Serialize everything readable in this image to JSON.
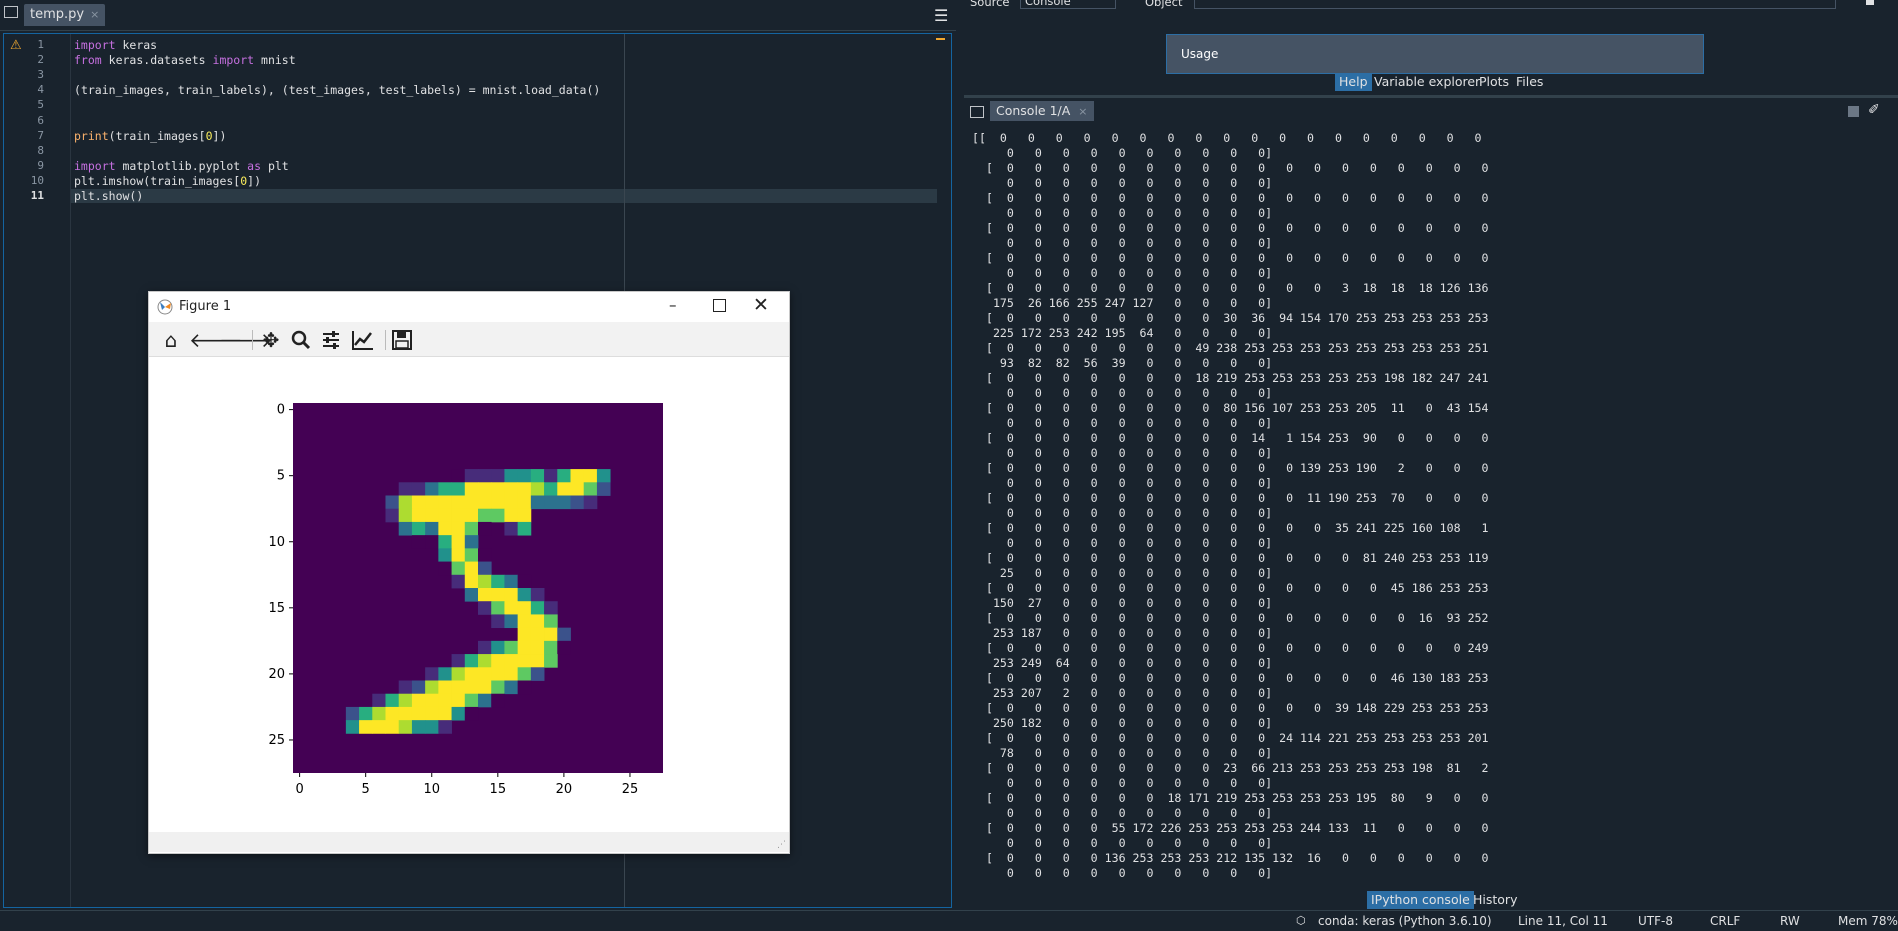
{
  "editor": {
    "tab_label": "temp.py",
    "tab_close": "×",
    "lines": [
      {
        "n": "1",
        "code": "import keras"
      },
      {
        "n": "2",
        "code": "from keras.datasets import mnist"
      },
      {
        "n": "3",
        "code": ""
      },
      {
        "n": "4",
        "code": "(train_images, train_labels), (test_images, test_labels) = mnist.load_data()"
      },
      {
        "n": "5",
        "code": ""
      },
      {
        "n": "6",
        "code": ""
      },
      {
        "n": "7",
        "code": "print(train_images[0])"
      },
      {
        "n": "8",
        "code": ""
      },
      {
        "n": "9",
        "code": "import matplotlib.pyplot as plt"
      },
      {
        "n": "10",
        "code": "plt.imshow(train_images[0])"
      },
      {
        "n": "11",
        "code": "plt.show()"
      }
    ]
  },
  "figure": {
    "title": "Figure 1",
    "y_ticks": [
      "0",
      "5",
      "10",
      "15",
      "20",
      "25"
    ],
    "x_ticks": [
      "0",
      "5",
      "10",
      "15",
      "20",
      "25"
    ],
    "colors": {
      "background": "#440154",
      "foreground": "#fde725"
    }
  },
  "right_pane": {
    "top_labels": {
      "source": "Source",
      "source_value": "Console",
      "object": "Object"
    },
    "usage_label": "Usage",
    "tabs": [
      "Help",
      "Variable explorer",
      "Plots",
      "Files"
    ],
    "console_tab": "Console 1/A",
    "console_tab_close": "×",
    "bottom_tabs": [
      "IPython console",
      "History"
    ],
    "console_lines": [
      "[[  0   0   0   0   0   0   0   0   0   0   0   0   0   0   0   0   0   0",
      "     0   0   0   0   0   0   0   0   0   0]",
      "  [  0   0   0   0   0   0   0   0   0   0   0   0   0   0   0   0   0   0",
      "     0   0   0   0   0   0   0   0   0   0]",
      "  [  0   0   0   0   0   0   0   0   0   0   0   0   0   0   0   0   0   0",
      "     0   0   0   0   0   0   0   0   0   0]",
      "  [  0   0   0   0   0   0   0   0   0   0   0   0   0   0   0   0   0   0",
      "     0   0   0   0   0   0   0   0   0   0]",
      "  [  0   0   0   0   0   0   0   0   0   0   0   0   0   0   0   0   0   0",
      "     0   0   0   0   0   0   0   0   0   0]",
      "  [  0   0   0   0   0   0   0   0   0   0   0   0   3  18  18  18 126 136",
      "   175  26 166 255 247 127   0   0   0   0]",
      "  [  0   0   0   0   0   0   0   0  30  36  94 154 170 253 253 253 253 253",
      "   225 172 253 242 195  64   0   0   0   0]",
      "  [  0   0   0   0   0   0   0  49 238 253 253 253 253 253 253 253 253 251",
      "    93  82  82  56  39   0   0   0   0   0]",
      "  [  0   0   0   0   0   0   0  18 219 253 253 253 253 253 198 182 247 241",
      "     0   0   0   0   0   0   0   0   0   0]",
      "  [  0   0   0   0   0   0   0   0  80 156 107 253 253 205  11   0  43 154",
      "     0   0   0   0   0   0   0   0   0   0]",
      "  [  0   0   0   0   0   0   0   0   0  14   1 154 253  90   0   0   0   0",
      "     0   0   0   0   0   0   0   0   0   0]",
      "  [  0   0   0   0   0   0   0   0   0   0   0 139 253 190   2   0   0   0",
      "     0   0   0   0   0   0   0   0   0   0]",
      "  [  0   0   0   0   0   0   0   0   0   0   0  11 190 253  70   0   0   0",
      "     0   0   0   0   0   0   0   0   0   0]",
      "  [  0   0   0   0   0   0   0   0   0   0   0   0  35 241 225 160 108   1",
      "     0   0   0   0   0   0   0   0   0   0]",
      "  [  0   0   0   0   0   0   0   0   0   0   0   0   0  81 240 253 253 119",
      "    25   0   0   0   0   0   0   0   0   0]",
      "  [  0   0   0   0   0   0   0   0   0   0   0   0   0   0  45 186 253 253",
      "   150  27   0   0   0   0   0   0   0   0]",
      "  [  0   0   0   0   0   0   0   0   0   0   0   0   0   0   0  16  93 252",
      "   253 187   0   0   0   0   0   0   0   0]",
      "  [  0   0   0   0   0   0   0   0   0   0   0   0   0   0   0   0   0 249",
      "   253 249  64   0   0   0   0   0   0   0]",
      "  [  0   0   0   0   0   0   0   0   0   0   0   0   0   0  46 130 183 253",
      "   253 207   2   0   0   0   0   0   0   0]",
      "  [  0   0   0   0   0   0   0   0   0   0   0   0  39 148 229 253 253 253",
      "   250 182   0   0   0   0   0   0   0   0]",
      "  [  0   0   0   0   0   0   0   0   0   0  24 114 221 253 253 253 253 201",
      "    78   0   0   0   0   0   0   0   0   0]",
      "  [  0   0   0   0   0   0   0   0  23  66 213 253 253 253 253 198  81   2",
      "     0   0   0   0   0   0   0   0   0   0]",
      "  [  0   0   0   0   0   0  18 171 219 253 253 253 253 195  80   9   0   0",
      "     0   0   0   0   0   0   0   0   0   0]",
      "  [  0   0   0   0  55 172 226 253 253 253 253 244 133  11   0   0   0   0",
      "     0   0   0   0   0   0   0   0   0   0]",
      "  [  0   0   0   0 136 253 253 253 212 135 132  16   0   0   0   0   0   0",
      "     0   0   0   0   0   0   0   0   0   0]"
    ]
  },
  "status": {
    "env": "conda: keras (Python 3.6.10)",
    "position": "Line 11, Col 11",
    "encoding": "UTF-8",
    "eol": "CRLF",
    "rw": "RW",
    "mem": "Mem 78%"
  }
}
